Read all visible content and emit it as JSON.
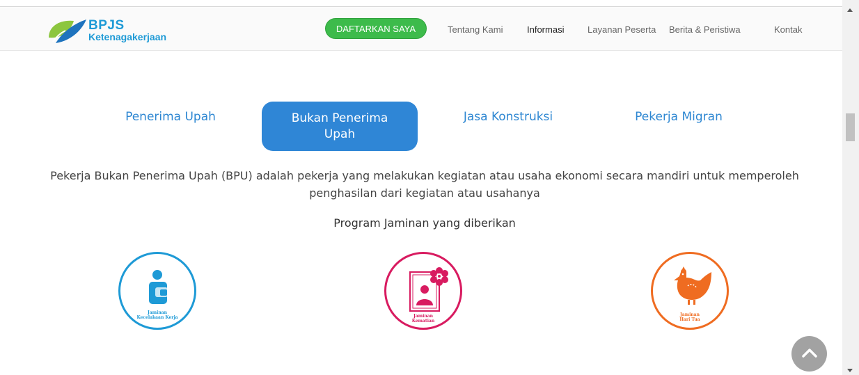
{
  "header": {
    "brand": {
      "name": "BPJS",
      "subtitle": "Ketenagakerjaan"
    },
    "cta_label": "DAFTARKAN SAYA",
    "nav": [
      {
        "label": "Tentang Kami"
      },
      {
        "label": "Informasi"
      },
      {
        "label": "Layanan Peserta"
      },
      {
        "label": "Berita & Peristiwa"
      },
      {
        "label": "Kontak"
      }
    ]
  },
  "tabs": [
    {
      "label": "Penerima Upah",
      "active": false
    },
    {
      "label": "Bukan Penerima Upah",
      "active": true
    },
    {
      "label": "Jasa Konstruksi",
      "active": false
    },
    {
      "label": "Pekerja Migran",
      "active": false
    }
  ],
  "content": {
    "description": "Pekerja Bukan Penerima Upah (BPU) adalah pekerja yang melakukan kegiatan atau usaha ekonomi secara mandiri untuk memperoleh penghasilan dari kegiatan atau usahanya",
    "programs_heading": "Program Jaminan yang diberikan",
    "programs": [
      {
        "icon": "worker-injury-icon",
        "label_line1": "Jaminan",
        "label_line2": "Kecelakaan Kerja",
        "color": "#1e9ad6"
      },
      {
        "icon": "death-benefit-icon",
        "label_line1": "Jaminan",
        "label_line2": "Kematian",
        "color": "#d81b60"
      },
      {
        "icon": "hen-icon",
        "label_line1": "Jaminan",
        "label_line2": "Hari Tua",
        "color": "#ef6c21"
      }
    ]
  },
  "colors": {
    "brand_blue": "#1e9ad6",
    "cta_green": "#3dbb4b",
    "tab_active": "#2f86d6"
  }
}
